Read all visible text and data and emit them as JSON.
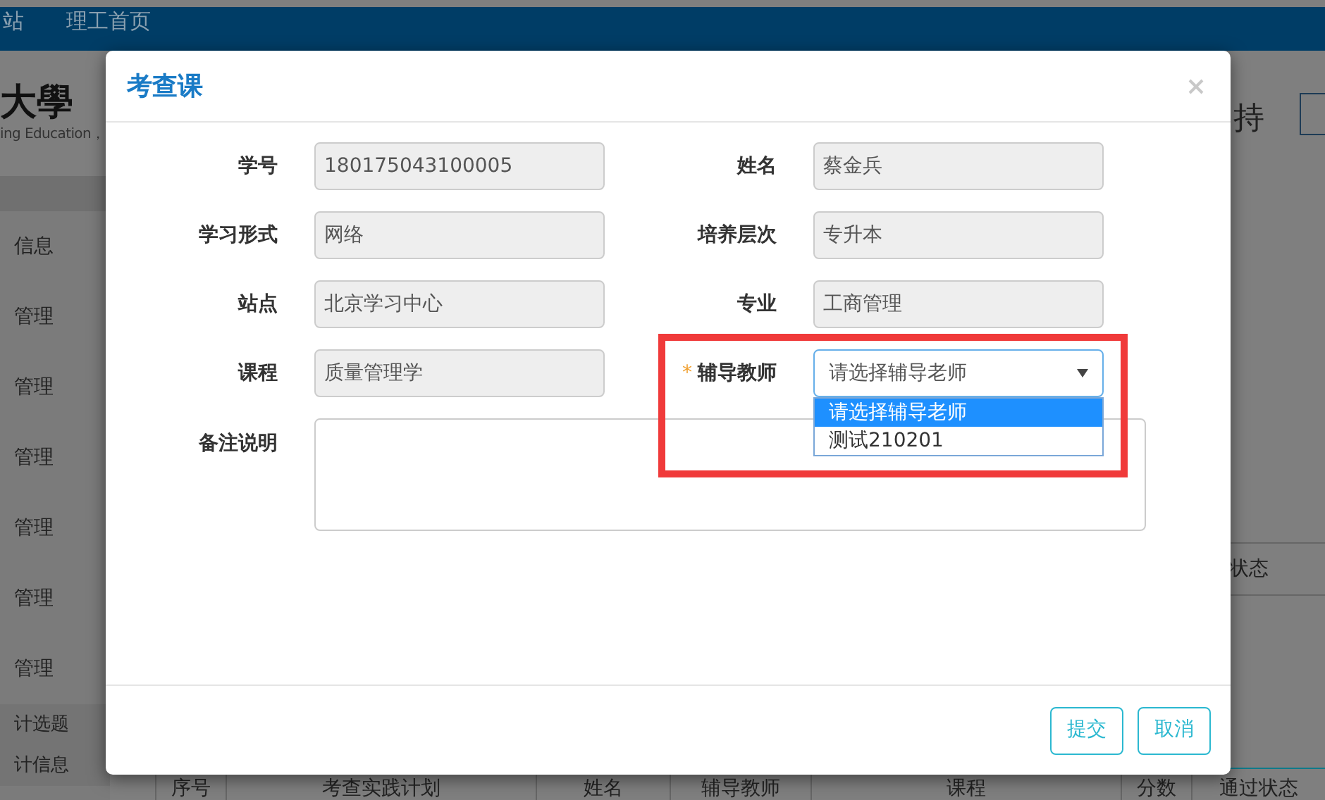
{
  "top_nav": {
    "links": [
      "站",
      "理工首页"
    ]
  },
  "logo": {
    "title": "大學",
    "subtitle": "ing Education，"
  },
  "header_right": {
    "text": "持"
  },
  "sidebar": {
    "items": [
      {
        "label": "信息",
        "kind": "main"
      },
      {
        "label": "管理",
        "kind": "main"
      },
      {
        "label": "管理",
        "kind": "main"
      },
      {
        "label": "管理",
        "kind": "main"
      },
      {
        "label": "管理",
        "kind": "main"
      },
      {
        "label": "管理",
        "kind": "main"
      },
      {
        "label": "管理",
        "kind": "main"
      },
      {
        "label": "计选题",
        "kind": "sub"
      },
      {
        "label": "计信息",
        "kind": "sub"
      }
    ]
  },
  "background_table": {
    "partial_header": "状态",
    "columns": [
      "序号",
      "考查实践计划",
      "姓名",
      "辅导教师",
      "课程",
      "分数",
      "通过状态"
    ]
  },
  "dialog": {
    "title": "考查课",
    "fields": [
      {
        "label": "学号",
        "value": "180175043100005"
      },
      {
        "label": "姓名",
        "value": "蔡金兵"
      },
      {
        "label": "学习形式",
        "value": "网络"
      },
      {
        "label": "培养层次",
        "value": "专升本"
      },
      {
        "label": "站点",
        "value": "北京学习中心"
      },
      {
        "label": "专业",
        "value": "工商管理"
      },
      {
        "label": "课程",
        "value": "质量管理学"
      }
    ],
    "select": {
      "label": "辅导教师",
      "required_mark": "*",
      "value": "请选择辅导老师",
      "expanded": true,
      "options": [
        {
          "label": "请选择辅导老师",
          "selected": true
        },
        {
          "label": "测试210201",
          "selected": false
        }
      ]
    },
    "remarks": {
      "label": "备注说明"
    },
    "buttons": [
      "提交",
      "取消"
    ]
  }
}
